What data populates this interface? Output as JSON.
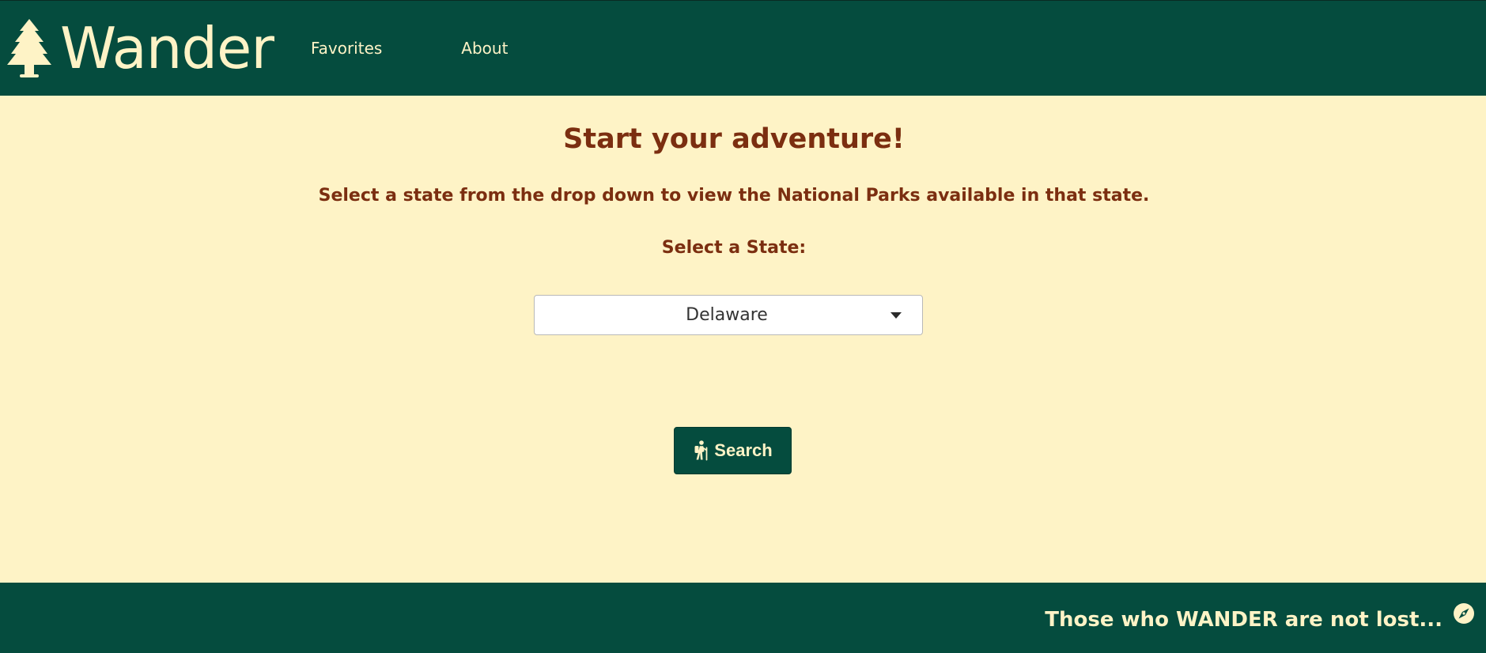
{
  "header": {
    "brand": {
      "name": "Wander",
      "icon": "tree-icon"
    },
    "nav": [
      {
        "label": "Favorites"
      },
      {
        "label": "About"
      }
    ]
  },
  "main": {
    "heading": "Start your adventure!",
    "instructions": "Select a state from the drop down to view the National Parks available in that state.",
    "select_label": "Select a State:",
    "state_select": {
      "selected": "Delaware",
      "icon": "chevron-down-icon"
    },
    "search_button": {
      "label": "Search",
      "icon": "hiker-icon"
    }
  },
  "footer": {
    "tagline": "Those who WANDER are not lost...",
    "icon": "compass-icon"
  },
  "colors": {
    "primary": "#054c3e",
    "background": "#fef3c6",
    "accent_text": "#7b2e10",
    "light_text": "#fef3c6"
  }
}
